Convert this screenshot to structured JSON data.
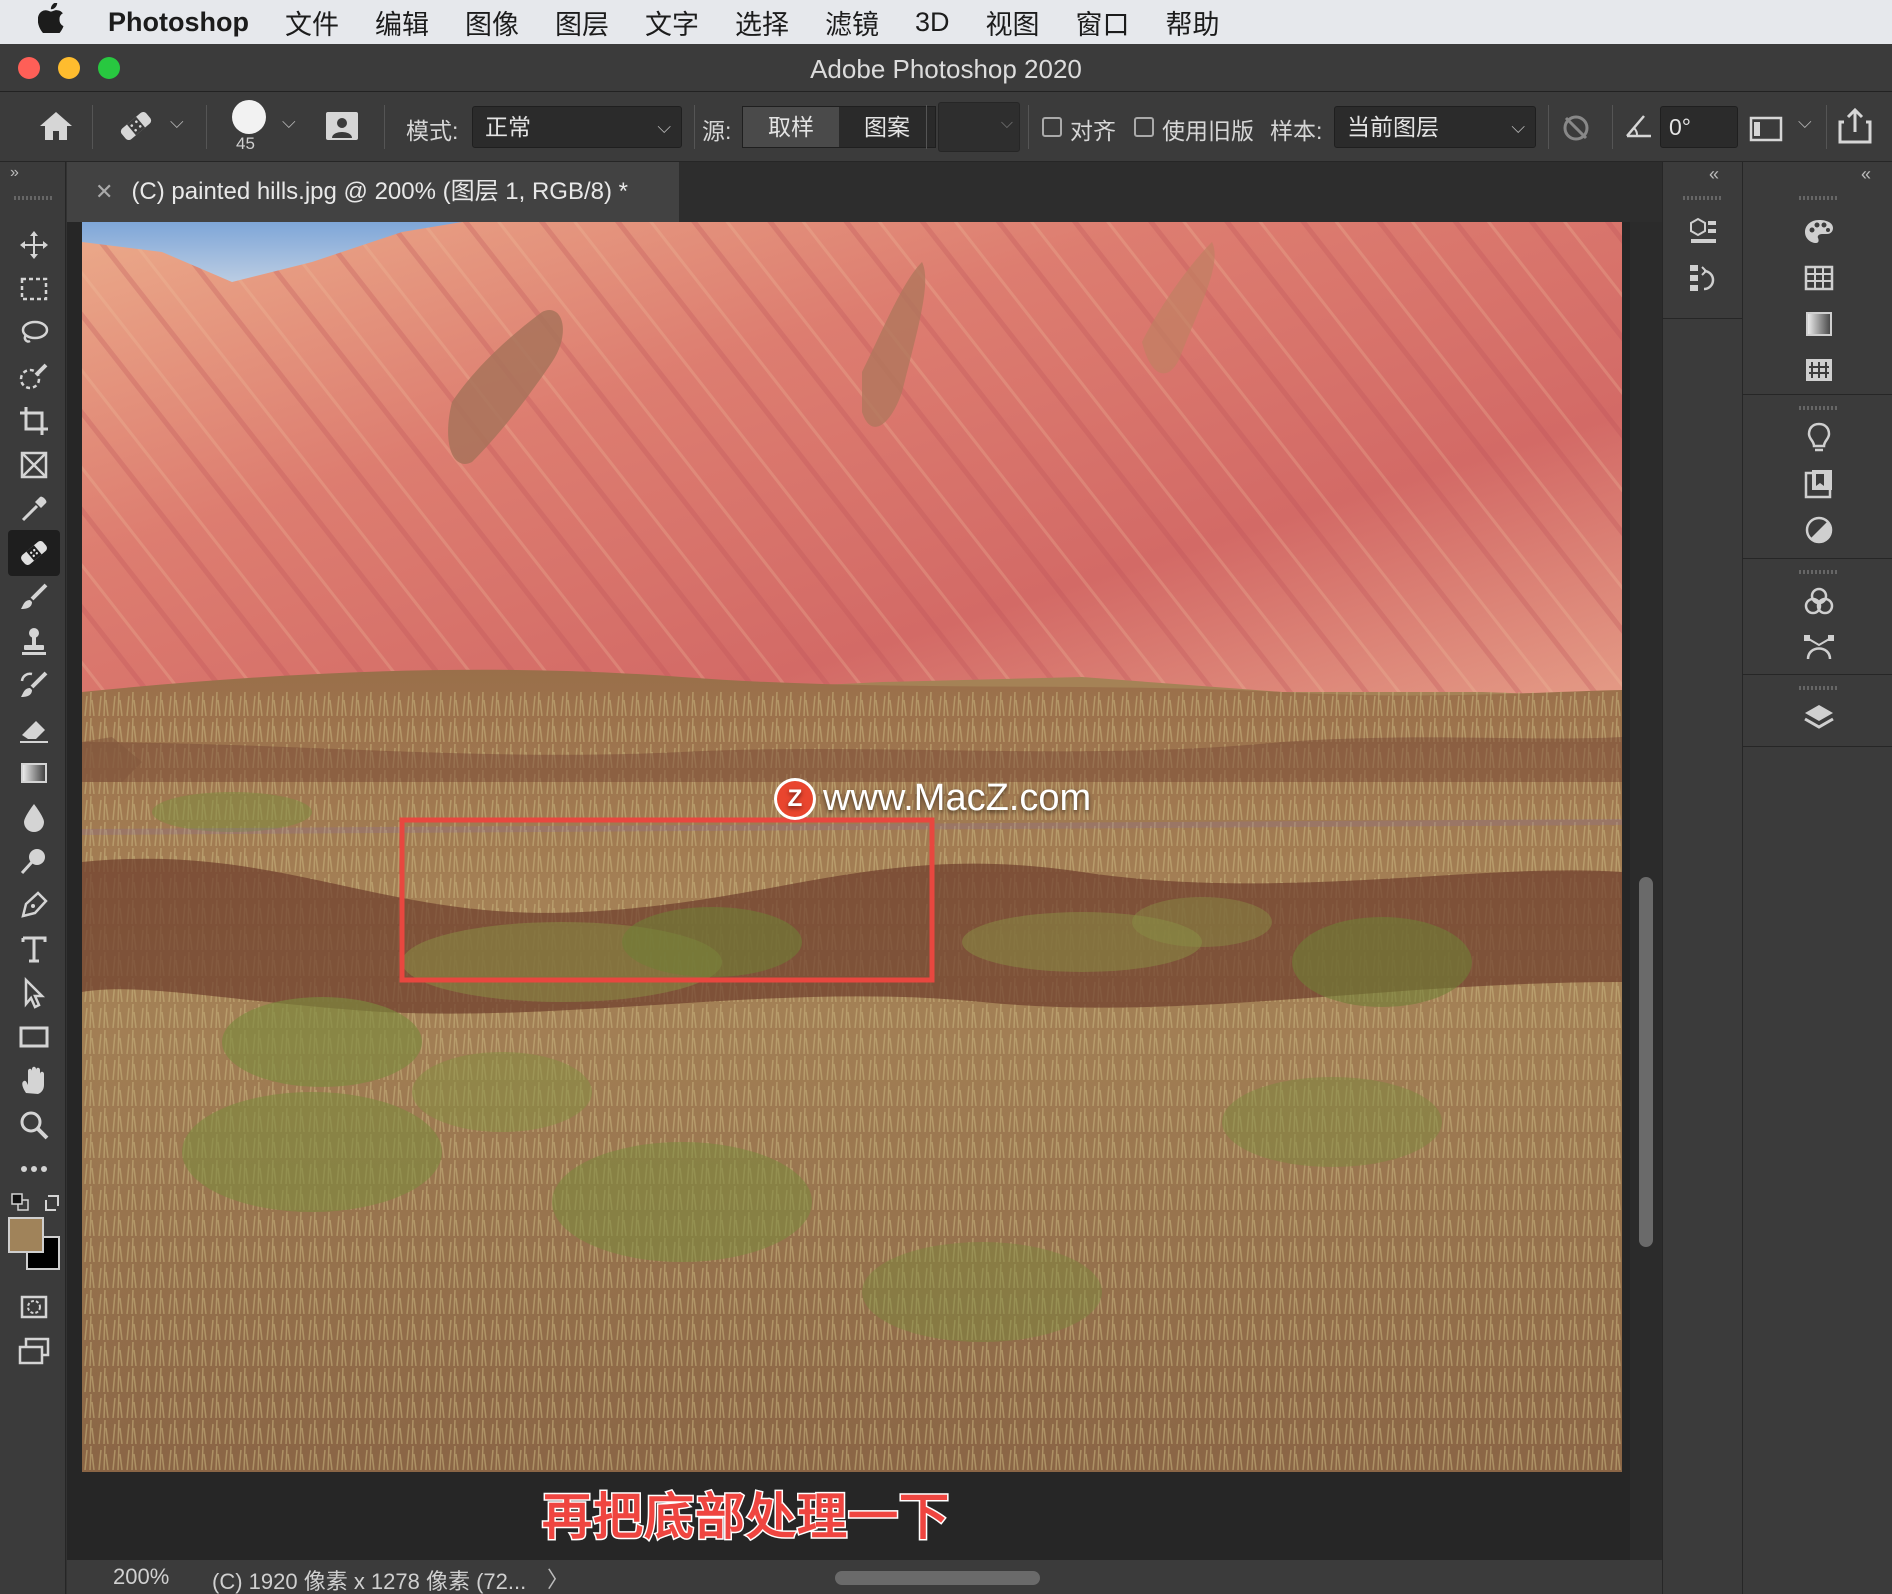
{
  "menubar": {
    "app": "Photoshop",
    "items": [
      "文件",
      "编辑",
      "图像",
      "图层",
      "文字",
      "选择",
      "滤镜",
      "3D",
      "视图",
      "窗口",
      "帮助"
    ]
  },
  "window": {
    "title": "Adobe Photoshop 2020"
  },
  "options": {
    "brush_size": "45",
    "mode_label": "模式:",
    "mode_value": "正常",
    "source_label": "源:",
    "source_sampled": "取样",
    "source_pattern": "图案",
    "aligned_label": "对齐",
    "legacy_label": "使用旧版",
    "sample_label": "样本:",
    "sample_value": "当前图层",
    "angle_value": "0°"
  },
  "document": {
    "tab_title": "(C) painted hills.jpg @ 200% (图层 1, RGB/8) *",
    "watermark": "www.MacZ.com",
    "watermark_logo": "Z",
    "caption": "再把底部处理一下"
  },
  "status": {
    "zoom": "200%",
    "info": "(C) 1920 像素 x 1278 像素 (72...",
    "arrow": "〉"
  },
  "colors": {
    "foreground": "#a0835a",
    "background": "#000000",
    "highlight_box": "#e8473f"
  }
}
